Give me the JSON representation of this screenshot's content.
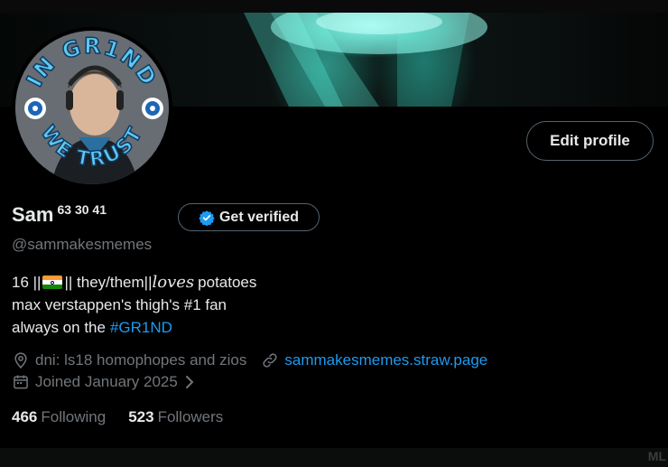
{
  "top_ghost_left": "",
  "top_ghost_right": "",
  "profile": {
    "display_name": "Sam",
    "name_suffix": "63 30 41",
    "handle": "@sammakesmemes",
    "avatar_text_top": "IN GR1ND",
    "avatar_text_bottom": "WE TRUST"
  },
  "buttons": {
    "edit_profile": "Edit profile",
    "get_verified": "Get verified"
  },
  "bio": {
    "line1_a": "16 ||",
    "line1_b": "|| they/them||",
    "line1_loves": "loves",
    "line1_c": "potatoes",
    "line2": "max verstappen's thigh's #1 fan",
    "line3": "always on the",
    "hashtag": "#GR1ND"
  },
  "meta": {
    "location": "dni: ls18 homophopes and zios",
    "website": "sammakesmemes.straw.page",
    "joined": "Joined January 2025"
  },
  "stats": {
    "following_count": "466",
    "following_label": "Following",
    "followers_count": "523",
    "followers_label": "Followers"
  },
  "bottom_ghost_left": "",
  "bottom_ghost_right": "ML",
  "colors": {
    "accent": "#1d9bf0",
    "muted": "#71767b",
    "text": "#e7e9ea",
    "border": "#536471",
    "avatar_ring": "#5ec8f0"
  },
  "icons": [
    "location-icon",
    "link-icon",
    "calendar-icon",
    "chevron-right-icon",
    "verified-badge-icon"
  ]
}
